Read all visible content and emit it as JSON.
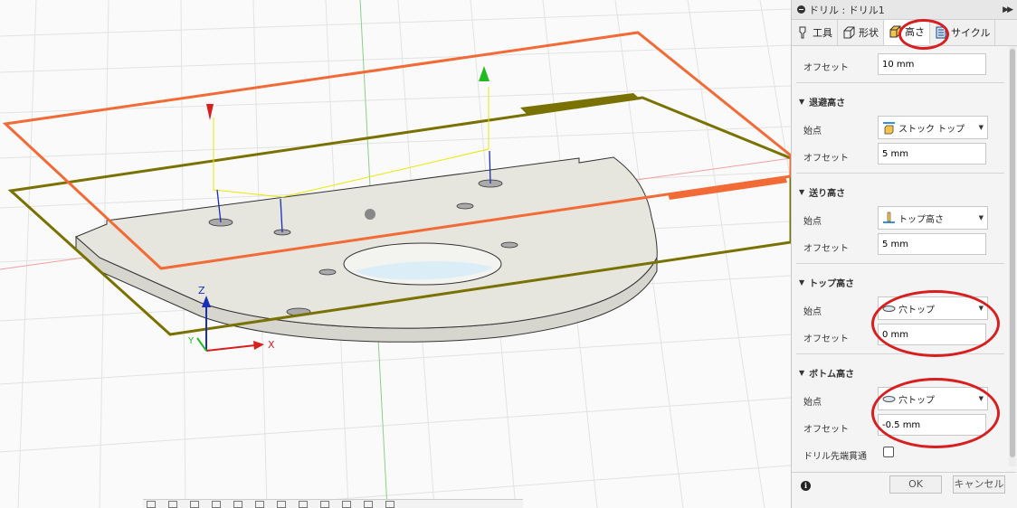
{
  "panel": {
    "title": "ドリル : ドリル1",
    "tabs": [
      {
        "label": "工具",
        "icon": "tool-icon"
      },
      {
        "label": "形状",
        "icon": "shape-icon"
      },
      {
        "label": "高さ",
        "icon": "heights-icon",
        "active": true
      },
      {
        "label": "サイクル",
        "icon": "cycle-icon"
      }
    ],
    "top_offset": {
      "label": "オフセット",
      "value": "10 mm"
    },
    "retract": {
      "heading": "退避高さ",
      "from_label": "始点",
      "from_value": "ストック トップ",
      "offset_label": "オフセット",
      "offset_value": "5 mm"
    },
    "feed": {
      "heading": "送り高さ",
      "from_label": "始点",
      "from_value": "トップ高さ",
      "offset_label": "オフセット",
      "offset_value": "5 mm"
    },
    "top": {
      "heading": "トップ高さ",
      "from_label": "始点",
      "from_value": "穴トップ",
      "offset_label": "オフセット",
      "offset_value": "0 mm"
    },
    "bottom": {
      "heading": "ボトム高さ",
      "from_label": "始点",
      "from_value": "穴トップ",
      "offset_label": "オフセット",
      "offset_value": "-0.5 mm"
    },
    "drill_tip": {
      "label": "ドリル先端貫通",
      "checked": false
    },
    "ok_label": "OK",
    "cancel_label": "キャンセル",
    "info_symbol": "i"
  },
  "viewport": {
    "axis_z": "Z",
    "axis_x": "X",
    "axis_y": "Y"
  },
  "colors": {
    "annotation": "#d81e1e",
    "stock_plane": "#f26a35",
    "feed_plane": "#7a7200",
    "part_fill": "#e6e5de"
  }
}
